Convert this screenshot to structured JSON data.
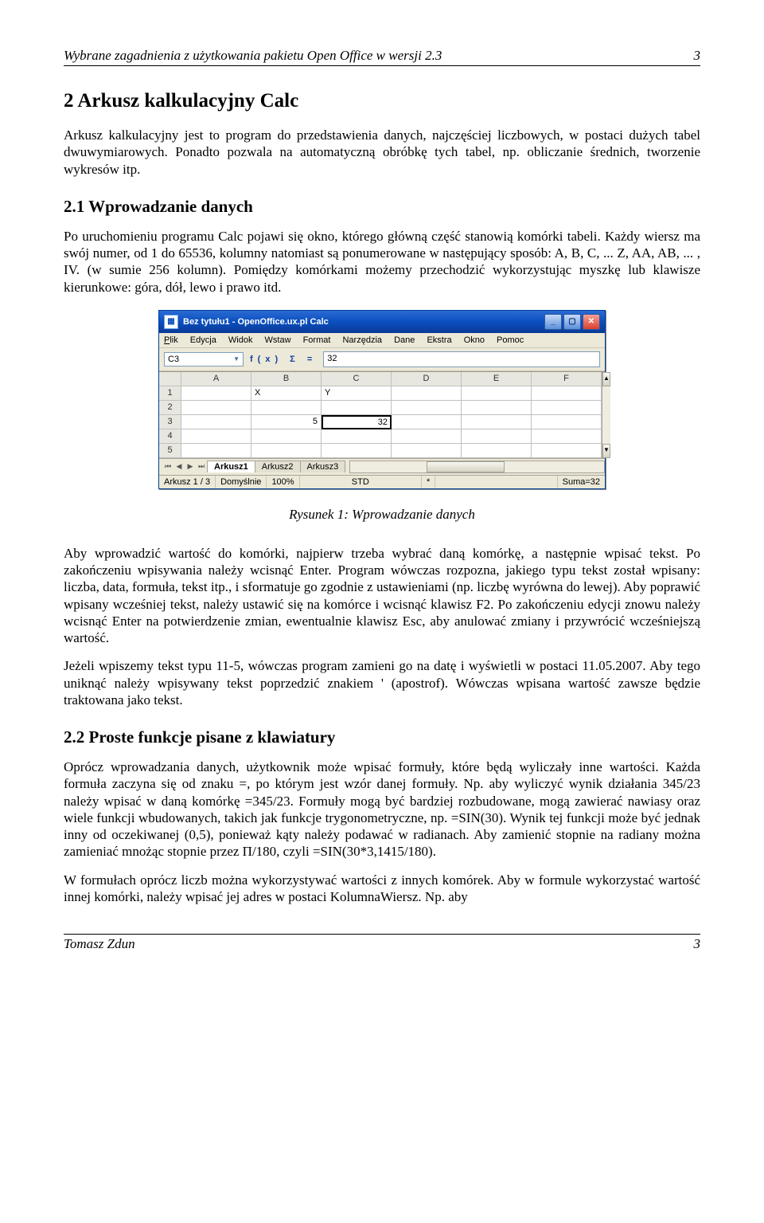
{
  "header": {
    "title": "Wybrane zagadnienia z użytkowania pakietu Open Office w wersji 2.3",
    "page_top": "3"
  },
  "section2": {
    "heading": "2  Arkusz kalkulacyjny Calc",
    "p1": "Arkusz kalkulacyjny jest to program do przedstawienia danych, najczęściej liczbowych, w postaci dużych tabel dwuwymiarowych. Ponadto pozwala na automatyczną obróbkę tych tabel, np. obliczanie średnich, tworzenie wykresów itp."
  },
  "section21": {
    "heading": "2.1  Wprowadzanie danych",
    "p1": "Po uruchomieniu programu Calc pojawi się okno, którego główną część stanowią komórki tabeli. Każdy wiersz ma swój numer, od 1 do 65536, kolumny natomiast są ponumerowane w następujący sposób: A, B, C, ... Z, AA, AB, ... , IV. (w sumie 256 kolumn). Pomiędzy komórkami możemy przechodzić wykorzystując myszkę lub klawisze kierunkowe: góra, dół, lewo i prawo itd.",
    "caption": "Rysunek 1: Wprowadzanie danych",
    "p2": "Aby wprowadzić wartość do komórki, najpierw trzeba wybrać daną komórkę, a następnie wpisać tekst. Po zakończeniu wpisywania należy wcisnąć Enter. Program wówczas rozpozna, jakiego typu tekst został wpisany: liczba, data, formuła, tekst itp., i sformatuje go zgodnie z ustawieniami (np. liczbę wyrówna do lewej). Aby poprawić wpisany wcześniej tekst, należy ustawić się na komórce i wcisnąć klawisz F2. Po zakończeniu edycji znowu należy wcisnąć Enter na potwierdzenie zmian, ewentualnie klawisz Esc, aby anulować zmiany i przywrócić wcześniejszą wartość.",
    "p3": "Jeżeli wpiszemy tekst typu 11-5, wówczas program zamieni go na datę i wyświetli w postaci 11.05.2007. Aby tego uniknąć należy wpisywany tekst poprzedzić znakiem ' (apostrof). Wówczas wpisana wartość zawsze będzie traktowana jako tekst."
  },
  "section22": {
    "heading": "2.2  Proste funkcje pisane z klawiatury",
    "p1": "Oprócz wprowadzania danych, użytkownik może wpisać formuły, które będą wyliczały inne wartości. Każda formuła zaczyna się od znaku =, po którym jest wzór danej formuły. Np. aby wyliczyć wynik działania 345/23 należy wpisać w daną komórkę =345/23. Formuły mogą być bardziej rozbudowane, mogą zawierać nawiasy oraz wiele funkcji wbudowanych, takich jak funkcje trygonometryczne, np. =SIN(30). Wynik tej funkcji może być jednak inny od oczekiwanej (0,5), ponieważ kąty należy podawać w radianach. Aby zamienić stopnie na radiany można zamieniać mnożąc stopnie przez Π/180, czyli =SIN(30*3,1415/180).",
    "p2": "W formułach oprócz liczb można wykorzystywać wartości z innych komórek. Aby w formule wykorzystać wartość innej komórki, należy wpisać jej adres w postaci KolumnaWiersz. Np. aby"
  },
  "calc": {
    "title": "Bez tytułu1 - OpenOffice.ux.pl Calc",
    "menu": {
      "plik": "Plik",
      "edycja": "Edycja",
      "widok": "Widok",
      "wstaw": "Wstaw",
      "format": "Format",
      "narzedzia": "Narzędzia",
      "dane": "Dane",
      "ekstra": "Ekstra",
      "okno": "Okno",
      "pomoc": "Pomoc"
    },
    "namebox": "C3",
    "fx_symbols": "f(x)   Σ    =",
    "formula_value": "32",
    "cols": {
      "A": "A",
      "B": "B",
      "C": "C",
      "D": "D",
      "E": "E",
      "F": "F"
    },
    "rows": {
      "r1": "1",
      "r2": "2",
      "r3": "3",
      "r4": "4",
      "r5": "5"
    },
    "cells": {
      "B1": "X",
      "C1": "Y",
      "B3": "5",
      "C3": "32"
    },
    "tabs": {
      "t1": "Arkusz1",
      "t2": "Arkusz2",
      "t3": "Arkusz3"
    },
    "status": {
      "sheet": "Arkusz 1 / 3",
      "style": "Domyślnie",
      "zoom": "100%",
      "mode": "STD",
      "mod": "*",
      "sum": "Suma=32"
    }
  },
  "footer": {
    "author": "Tomasz Zdun",
    "page": "3"
  }
}
